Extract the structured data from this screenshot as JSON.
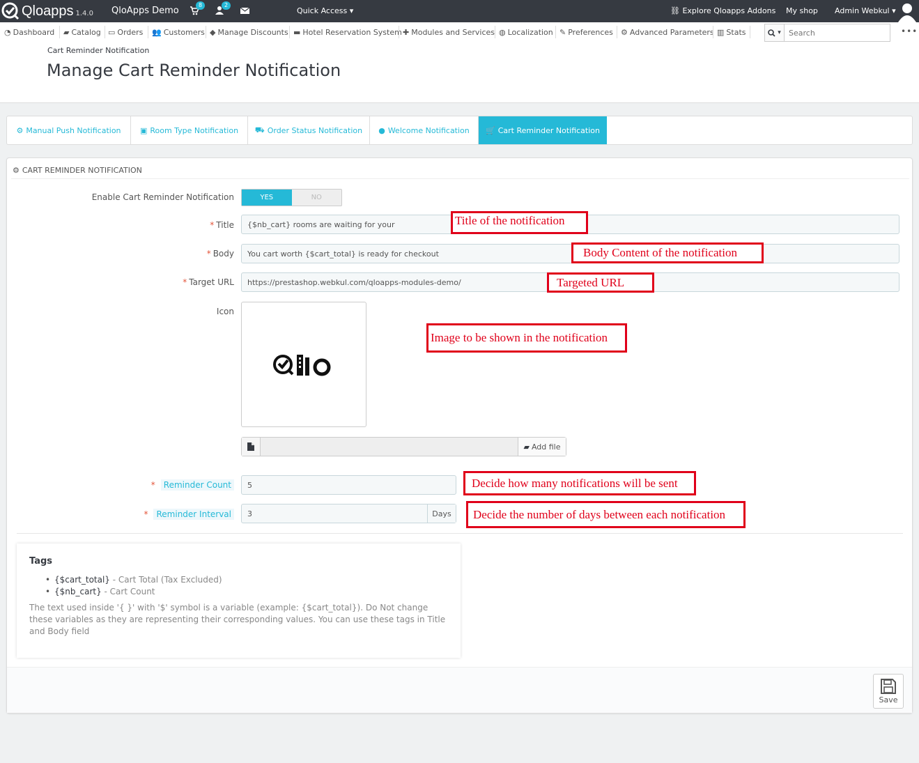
{
  "header": {
    "logo_text": "Qloapps",
    "version": "1.4.0",
    "shop_name": "QloApps Demo",
    "cart_count": "8",
    "customer_count": "2",
    "quick_access": "Quick Access",
    "explore_addons": "Explore Qloapps Addons",
    "my_shop": "My shop",
    "admin_user": "Admin Webkul"
  },
  "menu": {
    "items": [
      {
        "label": "Dashboard",
        "icon": "dashboard-icon"
      },
      {
        "label": "Catalog",
        "icon": "book-icon"
      },
      {
        "label": "Orders",
        "icon": "credit-card-icon"
      },
      {
        "label": "Customers",
        "icon": "users-icon"
      },
      {
        "label": "Manage Discounts",
        "icon": "tag-icon"
      },
      {
        "label": "Hotel Reservation System",
        "icon": "bed-icon"
      },
      {
        "label": "Modules and Services",
        "icon": "puzzle-icon"
      },
      {
        "label": "Localization",
        "icon": "globe-icon"
      },
      {
        "label": "Preferences",
        "icon": "wrench-icon"
      },
      {
        "label": "Advanced Parameters",
        "icon": "cogs-icon"
      },
      {
        "label": "Stats",
        "icon": "bar-chart-icon"
      }
    ],
    "search_placeholder": "Search"
  },
  "page": {
    "breadcrumb": "Cart Reminder Notification",
    "title": "Manage Cart Reminder Notification"
  },
  "tabs": [
    {
      "label": "Manual Push Notification",
      "icon": "cogs-icon",
      "active": false
    },
    {
      "label": "Room Type Notification",
      "icon": "archive-icon",
      "active": false
    },
    {
      "label": "Order Status Notification",
      "icon": "truck-icon",
      "active": false
    },
    {
      "label": "Welcome Notification",
      "icon": "user-icon",
      "active": false
    },
    {
      "label": "Cart Reminder Notification",
      "icon": "cart-icon",
      "active": true
    }
  ],
  "panel": {
    "heading": "Cart Reminder Notification",
    "enable_label": "Enable Cart Reminder Notification",
    "yes": "YES",
    "no": "NO",
    "enabled": true,
    "title_label": "Title",
    "title_value": "{$nb_cart} rooms are waiting for your",
    "body_label": "Body",
    "body_value": "You cart worth {$cart_total} is ready for checkout",
    "url_label": "Target URL",
    "url_value": "https://prestashop.webkul.com/qloapps-modules-demo/",
    "icon_label": "Icon",
    "add_file": "Add file",
    "reminder_count_label": "Reminder Count",
    "reminder_count_value": "5",
    "reminder_interval_label": "Reminder Interval",
    "reminder_interval_value": "3",
    "days_addon": "Days",
    "required_mark": "*"
  },
  "annotations": {
    "title": "Title of the notification",
    "body": "Body Content of the notification",
    "url": "Targeted URL",
    "image": "Image to be shown in the notification",
    "count": "Decide how many notifications will be sent",
    "interval": "Decide the number of days between each notification"
  },
  "tags": {
    "heading": "Tags",
    "items": [
      {
        "tag": "{$cart_total}",
        "desc": " - Cart Total (Tax Excluded)"
      },
      {
        "tag": "{$nb_cart}",
        "desc": " - Cart Count"
      }
    ],
    "note": "The text used inside '{ }' with '$' symbol is a variable (example: {$cart_total}). Do Not change these variables as they are representing their corresponding values. You can use these tags in Title and Body field"
  },
  "footer": {
    "save": "Save"
  },
  "colors": {
    "accent": "#25b9d7",
    "header_bg": "#363a41",
    "annotation": "#e0001a"
  }
}
